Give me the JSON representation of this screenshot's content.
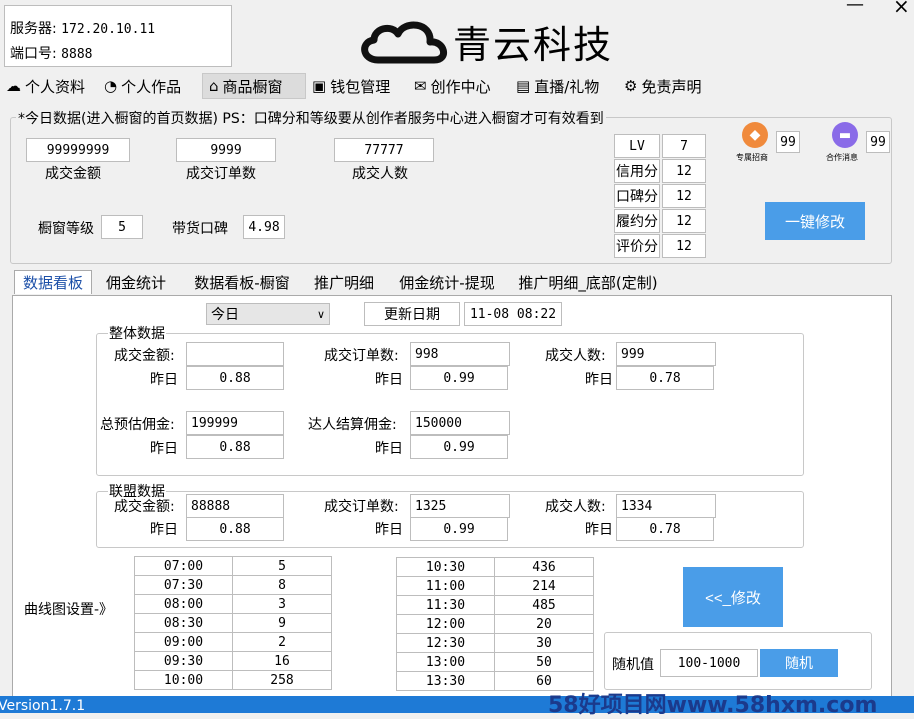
{
  "server": {
    "label": "服务器:",
    "value": "172.20.10.11"
  },
  "port": {
    "label": "端口号:",
    "value": "8888"
  },
  "logo_text": "青云科技",
  "window_controls": {
    "minimize": "—",
    "close": "×"
  },
  "top_nav": [
    {
      "label": "个人资料",
      "icon": "cloud-icon"
    },
    {
      "label": "个人作品",
      "icon": "palette-icon"
    },
    {
      "label": "商品橱窗",
      "icon": "store-icon"
    },
    {
      "label": "钱包管理",
      "icon": "wallet-icon"
    },
    {
      "label": "创作中心",
      "icon": "mail-icon"
    },
    {
      "label": "直播/礼物",
      "icon": "live-icon"
    },
    {
      "label": "免责声明",
      "icon": "gear-icon"
    }
  ],
  "today_data": {
    "title": "*今日数据(进入橱窗的首页数据) PS：口碑分和等级要从创作者服务中心进入橱窗才可有效看到",
    "gmv": {
      "value": "99999999",
      "label": "成交金额"
    },
    "orders": {
      "value": "9999",
      "label": "成交订单数"
    },
    "buyers": {
      "value": "77777",
      "label": "成交人数"
    },
    "shop_level": {
      "label": "橱窗等级",
      "value": "5"
    },
    "reputation": {
      "label": "带货口碑",
      "value": "4.98"
    },
    "scores": [
      {
        "label": "LV",
        "value": "7"
      },
      {
        "label": "信用分",
        "value": "12"
      },
      {
        "label": "口碑分",
        "value": "12"
      },
      {
        "label": "履约分",
        "value": "12"
      },
      {
        "label": "评价分",
        "value": "12"
      }
    ],
    "badge1": {
      "label": "专属招商",
      "count": "99"
    },
    "badge2": {
      "label": "合作消息",
      "count": "99"
    },
    "one_click_button": "一键修改"
  },
  "tabs": [
    "数据看板",
    "佣金统计",
    "数据看板-橱窗",
    "推广明细",
    "佣金统计-提现",
    "推广明细_底部(定制)"
  ],
  "period_select": "今日",
  "update_date": {
    "label": "更新日期",
    "value": "11-08 08:22"
  },
  "overall": {
    "title": "整体数据",
    "gmv_label": "成交金额:",
    "gmv_value": "",
    "orders_label": "成交订单数:",
    "orders_value": "998",
    "buyers_label": "成交人数:",
    "buyers_value": "999",
    "yesterday_label": "昨日",
    "gmv_y": "0.88",
    "orders_y": "0.99",
    "buyers_y": "0.78",
    "est_commission_label": "总预估佣金:",
    "est_commission_value": "199999",
    "settled_label": "达人结算佣金:",
    "settled_value": "150000",
    "est_y": "0.88",
    "settled_y": "0.99"
  },
  "alliance": {
    "title": "联盟数据",
    "gmv_label": "成交金额:",
    "gmv_value": "88888",
    "orders_label": "成交订单数:",
    "orders_value": "1325",
    "buyers_label": "成交人数:",
    "buyers_value": "1334",
    "yesterday_label": "昨日",
    "gmv_y": "0.88",
    "orders_y": "0.99",
    "buyers_y": "0.78"
  },
  "curve_label": "曲线图设置-》",
  "curve_left": [
    [
      "07:00",
      "5"
    ],
    [
      "07:30",
      "8"
    ],
    [
      "08:00",
      "3"
    ],
    [
      "08:30",
      "9"
    ],
    [
      "09:00",
      "2"
    ],
    [
      "09:30",
      "16"
    ],
    [
      "10:00",
      "258"
    ]
  ],
  "curve_right": [
    [
      "10:30",
      "436"
    ],
    [
      "11:00",
      "214"
    ],
    [
      "11:30",
      "485"
    ],
    [
      "12:00",
      "20"
    ],
    [
      "12:30",
      "30"
    ],
    [
      "13:00",
      "50"
    ],
    [
      "13:30",
      "60"
    ]
  ],
  "modify_button": "<<_修改",
  "random": {
    "label": "随机值",
    "value": "100-1000",
    "button": "随机"
  },
  "status_bar": {
    "version": "Version1.7.1",
    "watermark": "58好项目网www.58hxm.com"
  },
  "colors": {
    "accent": "#4a9de8",
    "status_bar": "#1e7ad6",
    "watermark": "#1b3a8c"
  }
}
